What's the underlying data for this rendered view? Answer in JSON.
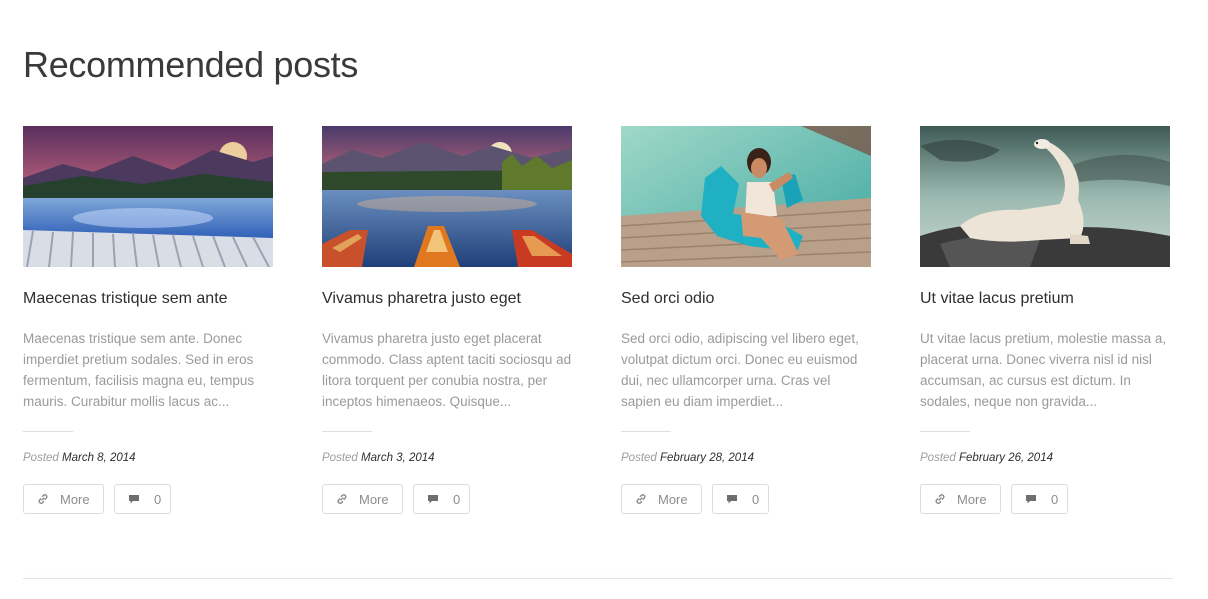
{
  "section": {
    "title": "Recommended posts"
  },
  "posts": [
    {
      "title": "Maecenas tristique sem ante",
      "excerpt": "Maecenas tristique sem ante. Donec imperdiet pretium sodales. Sed in eros fermentum, facilisis magna eu, tempus mauris. Curabitur mollis lacus ac...",
      "posted_label": "Posted",
      "date": "March 8, 2014",
      "more_label": "More",
      "comments": "0",
      "image": "mountain-lake-dock"
    },
    {
      "title": "Vivamus pharetra justo eget",
      "excerpt": "Vivamus pharetra justo eget placerat commodo. Class aptent taciti sociosqu ad litora torquent per conubia nostra, per inceptos himenaeos. Quisque...",
      "posted_label": "Posted",
      "date": "March 3, 2014",
      "more_label": "More",
      "comments": "0",
      "image": "mountain-lake-boats"
    },
    {
      "title": "Sed orci odio",
      "excerpt": "Sed orci odio, adipiscing vel libero eget, volutpat dictum orci. Donec eu euismod dui, nec ullamcorper urna. Cras vel sapien eu diam imperdiet...",
      "posted_label": "Posted",
      "date": "February 28, 2014",
      "more_label": "More",
      "comments": "0",
      "image": "pool-woman"
    },
    {
      "title": "Ut vitae lacus pretium",
      "excerpt": "Ut vitae lacus pretium, molestie massa a, placerat urna. Donec viverra nisl id nisl accumsan, ac cursus est dictum. In sodales, neque non gravida...",
      "posted_label": "Posted",
      "date": "February 26, 2014",
      "more_label": "More",
      "comments": "0",
      "image": "polar-bear"
    }
  ],
  "icons": {
    "more": "link-icon",
    "comments": "comment-icon"
  },
  "colors": {
    "title": "#2e2e2e",
    "muted": "#9a9a9a",
    "border": "#dcdcdc"
  }
}
